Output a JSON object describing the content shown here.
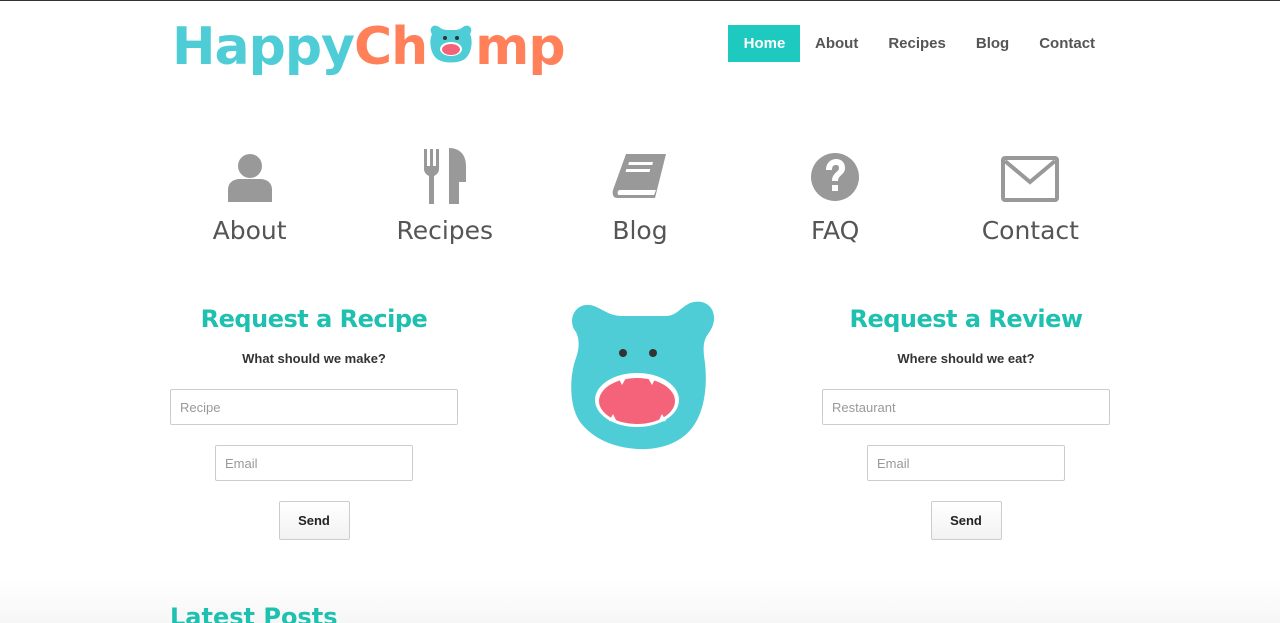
{
  "brand": {
    "logo_part1": "Happy",
    "logo_part2": "Ch",
    "logo_part3": "mp",
    "color_teal": "#4ecdd6",
    "color_orange": "#ff8059",
    "color_pink": "#f5637a"
  },
  "nav": {
    "items": [
      {
        "label": "Home",
        "active": true
      },
      {
        "label": "About"
      },
      {
        "label": "Recipes"
      },
      {
        "label": "Blog"
      },
      {
        "label": "Contact"
      }
    ],
    "active_color": "#1ec9bf"
  },
  "features": [
    {
      "label": "About",
      "icon": "user-icon"
    },
    {
      "label": "Recipes",
      "icon": "fork-knife-icon"
    },
    {
      "label": "Blog",
      "icon": "book-icon"
    },
    {
      "label": "FAQ",
      "icon": "question-icon"
    },
    {
      "label": "Contact",
      "icon": "envelope-icon"
    }
  ],
  "recipe_form": {
    "title": "Request a Recipe",
    "subtitle": "What should we make?",
    "field1_placeholder": "Recipe",
    "field2_placeholder": "Email",
    "button": "Send"
  },
  "review_form": {
    "title": "Request a Review",
    "subtitle": "Where should we eat?",
    "field1_placeholder": "Restaurant",
    "field2_placeholder": "Email",
    "button": "Send"
  },
  "latest": {
    "title": "Latest Posts"
  },
  "accent_color": "#1ec0b0"
}
